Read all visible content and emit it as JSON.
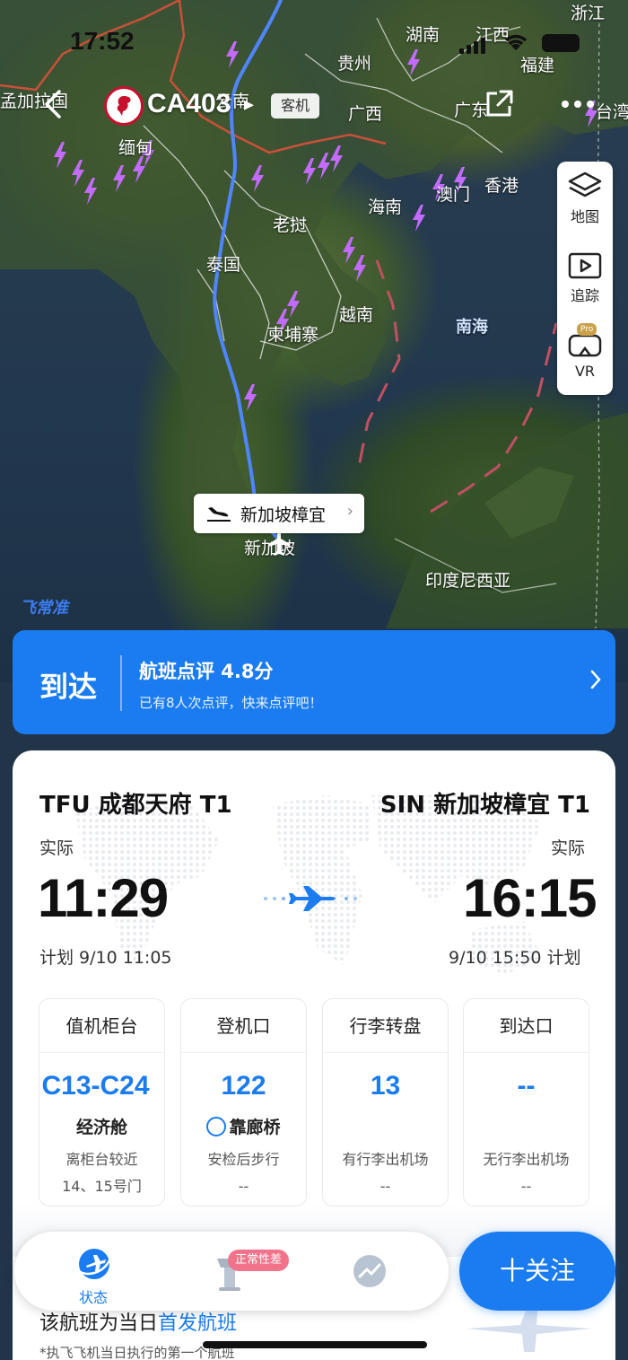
{
  "status_bar": {
    "time": "17:52"
  },
  "header": {
    "flight_no": "CA403",
    "type_badge": "客机"
  },
  "map": {
    "places": [
      "孟加拉国",
      "缅甸",
      "贵州",
      "湖南",
      "江西",
      "浙江",
      "福建",
      "广西",
      "广东",
      "台湾",
      "老挝",
      "泰国",
      "越南",
      "柬埔寨",
      "海南",
      "澳门",
      "香港",
      "南海",
      "印度尼西亚",
      "新加坡",
      "云南"
    ],
    "destination_pill": "新加坡樟宜",
    "watermark": "飞常准"
  },
  "tools": {
    "map": "地图",
    "track": "追踪",
    "vr": "VR",
    "pro": "Pro"
  },
  "arrival_banner": {
    "state": "到达",
    "title": "航班点评 4.8分",
    "subtitle": "已有8人次点评，快来点评吧！"
  },
  "route": {
    "from": "TFU 成都天府 T1",
    "to": "SIN 新加坡樟宜 T1",
    "dep_actual_label": "实际",
    "arr_actual_label": "实际",
    "dep_time": "11:29",
    "arr_time": "16:15",
    "dep_plan": "计划 9/10 11:05",
    "arr_plan": "9/10 15:50 计划"
  },
  "info": [
    {
      "header": "值机柜台",
      "value": "C13-C24",
      "sub": "经济舱",
      "note1": "离柜台较近",
      "note2": "14、15号门"
    },
    {
      "header": "登机口",
      "value": "122",
      "sub": "靠廊桥",
      "note1": "安检后步行",
      "note2": "--"
    },
    {
      "header": "行李转盘",
      "value": "13",
      "sub": "",
      "note1": "有行李出机场",
      "note2": "--"
    },
    {
      "header": "到达口",
      "value": "--",
      "sub": "",
      "note1": "无行李出机场",
      "note2": "--"
    }
  ],
  "first_flight": {
    "prefix": "该航班为当日",
    "highlight": "首发航班",
    "note": "*执飞飞机当日执行的第一个航班"
  },
  "tabbar": {
    "status": "状态",
    "punct_badge": "正常性差",
    "follow": "十关注"
  },
  "colors": {
    "accent": "#1a7cf0",
    "route_line": "#4f86ff",
    "storm": "#c46bff",
    "badge": "#f2728a"
  }
}
